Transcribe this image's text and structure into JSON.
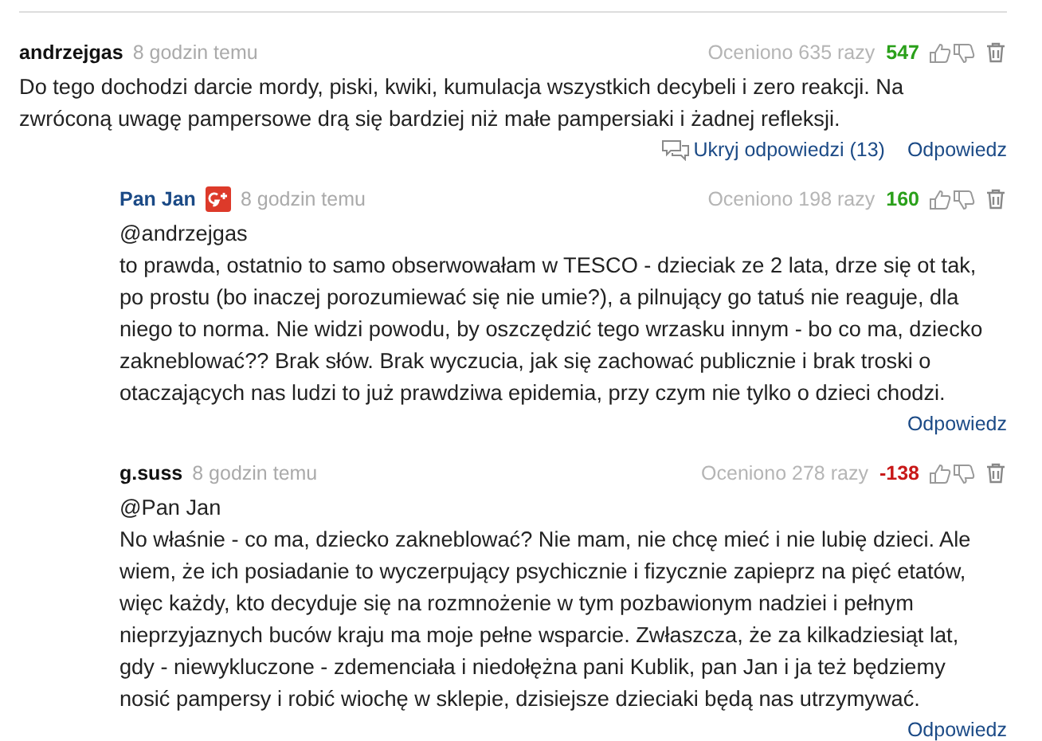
{
  "comments": [
    {
      "author": "andrzejgas",
      "profile_link": false,
      "google_plus": false,
      "time": "8 godzin temu",
      "rated": "Oceniono 635 razy",
      "score": {
        "text": "547",
        "positive": true
      },
      "body": "Do tego dochodzi darcie mordy, piski, kwiki, kumulacja wszystkich decybeli i zero reakcji. Na\nzwróconą uwagę pampersowe drą się bardziej niż małe pampersiaki i żadnej refleksji.",
      "hide_replies": "Ukryj odpowiedzi (13)",
      "reply": "Odpowiedz",
      "replies": [
        {
          "author": "Pan Jan",
          "profile_link": true,
          "google_plus": true,
          "time": "8 godzin temu",
          "rated": "Oceniono 198 razy",
          "score": {
            "text": "160",
            "positive": true
          },
          "body": "@andrzejgas\nto prawda, ostatnio to samo obserwowałam w TESCO - dzieciak ze 2 lata, drze się ot tak,\npo prostu (bo inaczej porozumiewać się nie umie?), a pilnujący go tatuś nie reaguje, dla\nniego to norma. Nie widzi powodu, by oszczędzić tego wrzasku innym - bo co ma, dziecko\nzakneblować?? Brak słów. Brak wyczucia, jak się zachować publicznie i brak troski o\notaczających nas ludzi to już prawdziwa epidemia, przy czym nie tylko o dzieci chodzi.",
          "reply": "Odpowiedz"
        },
        {
          "author": "g.suss",
          "profile_link": false,
          "google_plus": false,
          "time": "8 godzin temu",
          "rated": "Oceniono 278 razy",
          "score": {
            "text": "-138",
            "positive": false
          },
          "body": "@Pan Jan\nNo właśnie - co ma, dziecko zakneblować? Nie mam, nie chcę mieć i nie lubię dzieci. Ale\nwiem, że ich posiadanie to wyczerpujący psychicznie i fizycznie zapieprz na pięć etatów,\nwięc każdy, kto decyduje się na rozmnożenie w tym pozbawionym nadziei i pełnym\nnieprzyjaznych buców kraju ma moje pełne wsparcie. Zwłaszcza, że za kilkadziesiąt lat,\ngdy - niewykluczone - zdemenciała i niedołężna pani Kublik, pan Jan i ja też będziemy\nnosić pampersy i robić wiochę w sklepie, dzisiejsze dzieciaki będą nas utrzymywać.",
          "reply": "Odpowiedz"
        }
      ]
    }
  ]
}
